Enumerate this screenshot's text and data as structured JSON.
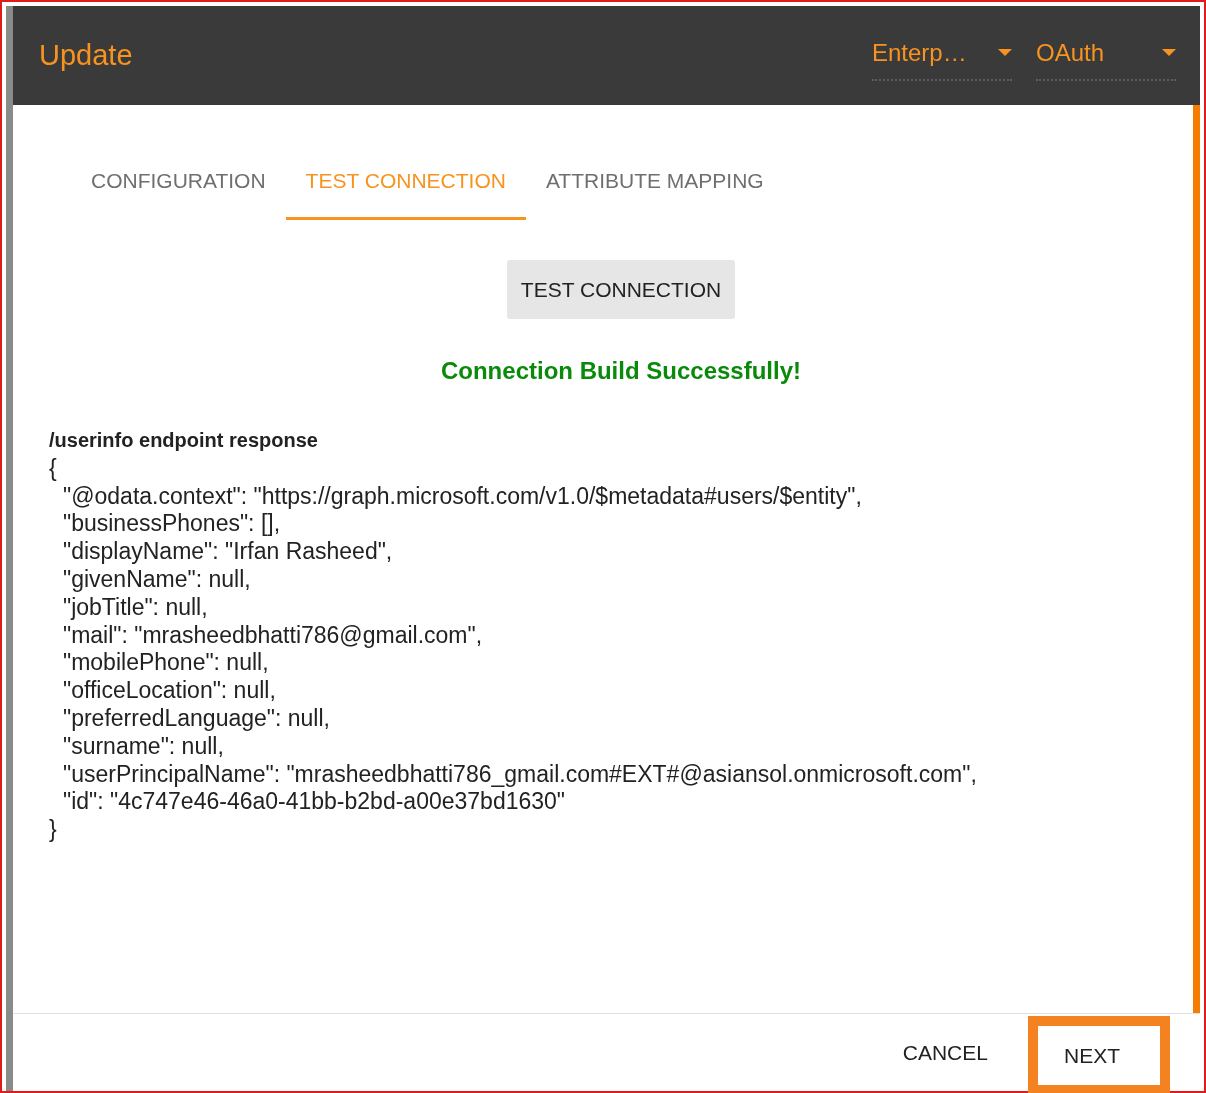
{
  "dialog": {
    "title": "Update",
    "selects": [
      {
        "value": "Enterp…"
      },
      {
        "value": "OAuth"
      }
    ]
  },
  "tabs": [
    {
      "label": "CONFIGURATION",
      "selected": false
    },
    {
      "label": "TEST CONNECTION",
      "selected": true
    },
    {
      "label": "ATTRIBUTE MAPPING",
      "selected": false
    }
  ],
  "test_button": "TEST CONNECTION",
  "status_message": "Connection Build Successfully!",
  "response": {
    "heading": "/userinfo endpoint response",
    "open": "{",
    "close": "}",
    "lines": [
      "\"@odata.context\": \"https://graph.microsoft.com/v1.0/$metadata#users/$entity\",",
      "\"businessPhones\": [],",
      "\"displayName\": \"Irfan Rasheed\",",
      "\"givenName\": null,",
      "\"jobTitle\": null,",
      "\"mail\": \"mrasheedbhatti786@gmail.com\",",
      "\"mobilePhone\": null,",
      "\"officeLocation\": null,",
      "\"preferredLanguage\": null,",
      "\"surname\": null,",
      "\"userPrincipalName\": \"mrasheedbhatti786_gmail.com#EXT#@asiansol.onmicrosoft.com\",",
      "\"id\": \"4c747e46-46a0-41bb-b2bd-a00e37bd1630\""
    ]
  },
  "footer": {
    "buttons": [
      {
        "label": "CANCEL",
        "highlighted": false
      },
      {
        "label": "NEXT",
        "highlighted": true
      }
    ]
  }
}
